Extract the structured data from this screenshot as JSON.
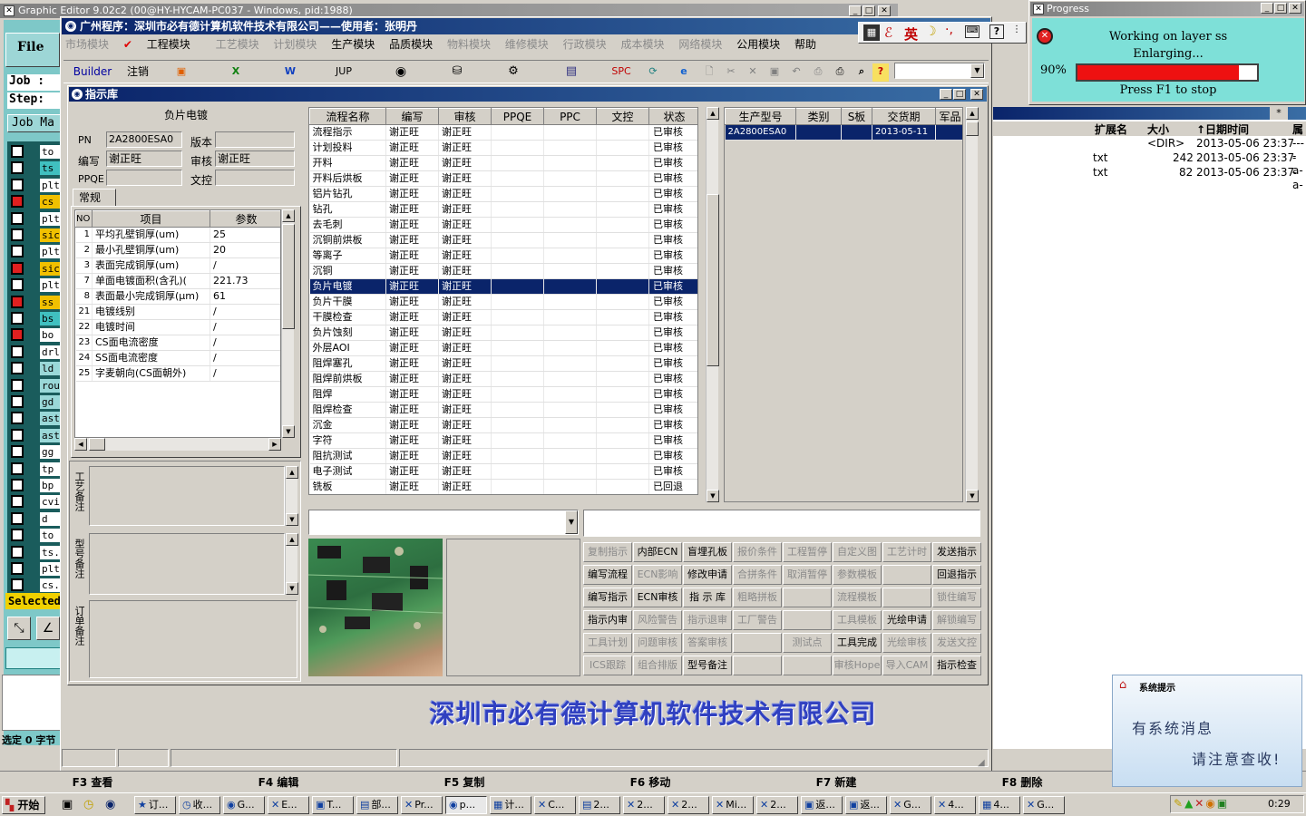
{
  "bg_window": {
    "title": "Graphic Editor 9.02c2 (00@HY-HYCAM-PC037 - Windows, pid:1988)",
    "file_menu": "File",
    "job_label": "Job :",
    "step_label": "Step:",
    "job_mat": "Job Ma",
    "selected_label": "Selected",
    "status_text": "选定 0 字节",
    "left_items": [
      "to",
      "ts",
      "plt",
      "cs",
      "plt",
      "sic",
      "plt",
      "sic",
      "plt",
      "ss",
      "bs",
      "bo",
      "drl",
      "ld",
      "rou",
      "gd",
      "ast",
      "ast",
      "gg",
      "tp",
      "bp",
      "cvi",
      "d",
      "to",
      "ts.",
      "plt",
      "cs."
    ]
  },
  "file_list": {
    "headers": [
      "扩展名",
      "大小",
      "↑日期时间",
      "属"
    ],
    "rows": [
      {
        "ext": "",
        "size": "<DIR>",
        "date": "2013-05-06 23:37",
        "attr": "----"
      },
      {
        "ext": "txt",
        "size": "242",
        "date": "2013-05-06 23:37",
        "attr": "-a-"
      },
      {
        "ext": "txt",
        "size": "82",
        "date": "2013-05-06 23:37",
        "attr": "-a-"
      }
    ]
  },
  "progress": {
    "title": "Progress",
    "line1": "Working on layer ss",
    "line2": "Enlarging...",
    "percent": "90%",
    "value": 0.9,
    "hint": "Press F1 to stop"
  },
  "main_window": {
    "title": "广州程序：深圳市必有德计算机软件技术有限公司——使用者：张明丹",
    "menus": [
      "市场模块",
      "工程模块",
      "工艺模块",
      "计划模块",
      "生产模块",
      "品质模块",
      "物料模块",
      "维修模块",
      "行政模块",
      "成本模块",
      "网络模块",
      "公用模块",
      "帮助"
    ],
    "toolbar": {
      "builder": "Builder",
      "logout": "注销",
      "jup": "JUP",
      "spc": "SPC"
    },
    "ime": "英",
    "company_banner": "深圳市必有德计算机软件技术有限公司"
  },
  "dialog": {
    "title": "指示库",
    "left": {
      "panel_title": "负片电镀",
      "pn_label": "PN",
      "pn_value": "2A2800ESA0",
      "version_label": "版本",
      "version_value": "",
      "author_label": "编写",
      "author_value": "谢正旺",
      "review_label": "审核",
      "review_value": "谢正旺",
      "ppqe_label": "PPQE",
      "ppqe_value": "",
      "doc_label": "文控",
      "doc_value": "",
      "tab": "常规",
      "param_headers": [
        "NO",
        "项目",
        "参数"
      ],
      "params": [
        {
          "no": "1",
          "item": "平均孔壁铜厚(um)",
          "val": "25"
        },
        {
          "no": "2",
          "item": "最小孔壁铜厚(um)",
          "val": "20"
        },
        {
          "no": "3",
          "item": "表面完成铜厚(um)",
          "val": "/"
        },
        {
          "no": "7",
          "item": "单面电镀面积(含孔)(",
          "val": "221.73"
        },
        {
          "no": "8",
          "item": "表面最小完成铜厚(μm)",
          "val": "61"
        },
        {
          "no": "21",
          "item": "电镀线别",
          "val": "/"
        },
        {
          "no": "22",
          "item": "电镀时间",
          "val": "/"
        },
        {
          "no": "23",
          "item": "CS面电流密度",
          "val": "/"
        },
        {
          "no": "24",
          "item": "SS面电流密度",
          "val": "/"
        },
        {
          "no": "25",
          "item": "字麦朝向(CS面朝外)",
          "val": "/"
        }
      ],
      "notes": [
        "工艺备注",
        "型号备注",
        "订单备注"
      ]
    },
    "flow": {
      "headers": [
        "流程名称",
        "编写",
        "审核",
        "PPQE",
        "PPC",
        "文控",
        "状态"
      ],
      "rows": [
        [
          "流程指示",
          "谢正旺",
          "谢正旺",
          "",
          "",
          "",
          "已审核"
        ],
        [
          "计划投料",
          "谢正旺",
          "谢正旺",
          "",
          "",
          "",
          "已审核"
        ],
        [
          "开料",
          "谢正旺",
          "谢正旺",
          "",
          "",
          "",
          "已审核"
        ],
        [
          "开料后烘板",
          "谢正旺",
          "谢正旺",
          "",
          "",
          "",
          "已审核"
        ],
        [
          "铝片钻孔",
          "谢正旺",
          "谢正旺",
          "",
          "",
          "",
          "已审核"
        ],
        [
          "钻孔",
          "谢正旺",
          "谢正旺",
          "",
          "",
          "",
          "已审核"
        ],
        [
          "去毛刺",
          "谢正旺",
          "谢正旺",
          "",
          "",
          "",
          "已审核"
        ],
        [
          "沉铜前烘板",
          "谢正旺",
          "谢正旺",
          "",
          "",
          "",
          "已审核"
        ],
        [
          "等离子",
          "谢正旺",
          "谢正旺",
          "",
          "",
          "",
          "已审核"
        ],
        [
          "沉铜",
          "谢正旺",
          "谢正旺",
          "",
          "",
          "",
          "已审核"
        ],
        [
          "负片电镀",
          "谢正旺",
          "谢正旺",
          "",
          "",
          "",
          "已审核"
        ],
        [
          "负片干膜",
          "谢正旺",
          "谢正旺",
          "",
          "",
          "",
          "已审核"
        ],
        [
          "干膜检查",
          "谢正旺",
          "谢正旺",
          "",
          "",
          "",
          "已审核"
        ],
        [
          "负片蚀刻",
          "谢正旺",
          "谢正旺",
          "",
          "",
          "",
          "已审核"
        ],
        [
          "外层AOI",
          "谢正旺",
          "谢正旺",
          "",
          "",
          "",
          "已审核"
        ],
        [
          "阻焊塞孔",
          "谢正旺",
          "谢正旺",
          "",
          "",
          "",
          "已审核"
        ],
        [
          "阻焊前烘板",
          "谢正旺",
          "谢正旺",
          "",
          "",
          "",
          "已审核"
        ],
        [
          "阻焊",
          "谢正旺",
          "谢正旺",
          "",
          "",
          "",
          "已审核"
        ],
        [
          "阻焊检查",
          "谢正旺",
          "谢正旺",
          "",
          "",
          "",
          "已审核"
        ],
        [
          "沉金",
          "谢正旺",
          "谢正旺",
          "",
          "",
          "",
          "已审核"
        ],
        [
          "字符",
          "谢正旺",
          "谢正旺",
          "",
          "",
          "",
          "已审核"
        ],
        [
          "阻抗测试",
          "谢正旺",
          "谢正旺",
          "",
          "",
          "",
          "已审核"
        ],
        [
          "电子测试",
          "谢正旺",
          "谢正旺",
          "",
          "",
          "",
          "已审核"
        ],
        [
          "铣板",
          "谢正旺",
          "谢正旺",
          "",
          "",
          "",
          "已回退"
        ]
      ],
      "selected_index": 10
    },
    "prod": {
      "headers": [
        "生产型号",
        "类别",
        "S板",
        "交货期",
        "军品"
      ],
      "rows": [
        [
          "2A2800ESA0",
          "",
          "",
          "2013-05-11",
          ""
        ]
      ]
    },
    "buttons": [
      [
        {
          "t": "复制指示",
          "d": true
        },
        {
          "t": "内部ECN",
          "d": false
        },
        {
          "t": "盲埋孔板",
          "d": false
        },
        {
          "t": "报价条件",
          "d": true
        },
        {
          "t": "工程暂停",
          "d": true
        },
        {
          "t": "自定义图",
          "d": true
        },
        {
          "t": "工艺计时",
          "d": true
        },
        {
          "t": "发送指示",
          "d": false
        }
      ],
      [
        {
          "t": "编写流程",
          "d": false
        },
        {
          "t": "ECN影响",
          "d": true
        },
        {
          "t": "修改申请",
          "d": false
        },
        {
          "t": "合拼条件",
          "d": true
        },
        {
          "t": "取消暂停",
          "d": true
        },
        {
          "t": "参数模板",
          "d": true
        },
        {
          "t": "",
          "d": true
        },
        {
          "t": "回退指示",
          "d": false
        }
      ],
      [
        {
          "t": "编写指示",
          "d": false
        },
        {
          "t": "ECN审核",
          "d": false
        },
        {
          "t": "指 示 库",
          "d": false
        },
        {
          "t": "粗略拼板",
          "d": true
        },
        {
          "t": "",
          "d": true
        },
        {
          "t": "流程模板",
          "d": true
        },
        {
          "t": "",
          "d": true
        },
        {
          "t": "锁住编写",
          "d": true
        }
      ],
      [
        {
          "t": "指示内审",
          "d": false
        },
        {
          "t": "风险警告",
          "d": true
        },
        {
          "t": "指示退审",
          "d": true
        },
        {
          "t": "工厂警告",
          "d": true
        },
        {
          "t": "",
          "d": true
        },
        {
          "t": "工具模板",
          "d": true
        },
        {
          "t": "光绘申请",
          "d": false
        },
        {
          "t": "解锁编写",
          "d": true
        }
      ],
      [
        {
          "t": "工具计划",
          "d": true
        },
        {
          "t": "问题审核",
          "d": true
        },
        {
          "t": "答案审核",
          "d": true
        },
        {
          "t": "",
          "d": true
        },
        {
          "t": "测试点",
          "d": true
        },
        {
          "t": "工具完成",
          "d": false
        },
        {
          "t": "光绘审核",
          "d": true
        },
        {
          "t": "发送文控",
          "d": true
        }
      ],
      [
        {
          "t": "ICS跟踪",
          "d": true
        },
        {
          "t": "组合排版",
          "d": true
        },
        {
          "t": "型号备注",
          "d": false
        },
        {
          "t": "",
          "d": true
        },
        {
          "t": "",
          "d": true
        },
        {
          "t": "审核Hope",
          "d": true
        },
        {
          "t": "导入CAM",
          "d": true
        },
        {
          "t": "指示检查",
          "d": false
        }
      ]
    ]
  },
  "fkeys": [
    "F3 查看",
    "F4 编辑",
    "F5 复制",
    "F6 移动",
    "F7 新建",
    "F8 删除"
  ],
  "notify": {
    "title": "系统提示",
    "line1": "有系统消息",
    "line2": "请注意查收!"
  },
  "taskbar": {
    "start": "开始",
    "items": [
      "订...",
      "收...",
      "G...",
      "E...",
      "T...",
      "部...",
      "Pr...",
      "p...",
      "计...",
      "C...",
      "2...",
      "2...",
      "2...",
      "Mi...",
      "2...",
      "返...",
      "返...",
      "G...",
      "4...",
      "4...",
      "G..."
    ],
    "clock": "0:29"
  },
  "colors": {
    "title_dark": "#0a246a",
    "title_light": "#3a6ea5",
    "teal": "#7ec8c8",
    "progress": "#ee1111",
    "banner": "#3040c0"
  }
}
